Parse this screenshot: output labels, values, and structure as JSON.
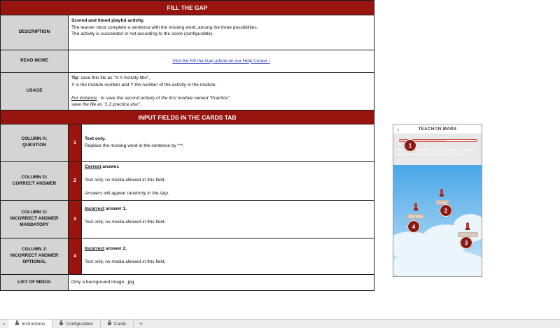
{
  "header": {
    "title": "FILL THE GAP"
  },
  "description": {
    "label": "DESCRIPTION",
    "lines": [
      "Scored and timed playful activity.",
      "The learner must complete a sentence with the missing word, among the three possibilities.",
      "The activity is succeeded or not according to the score (configurable)."
    ]
  },
  "read_more": {
    "label": "READ MORE",
    "link": "Visit the Fill the Gap article on our Help Center !"
  },
  "usage": {
    "label": "USAGE",
    "tip_label": "Tip",
    "tip_text": ": save this file as  \"X.Y-Activity title\",",
    "line2": "X is the module number and Y the number of the activity in the module.",
    "example_label": "For instance",
    "example_text": " : to save the second activity of the first module named \"Practice\",",
    "example_line2": "save the file as \"1.2.practice.xlsx\"."
  },
  "input_header": {
    "title": "INPUT FIELDS IN THE CARDS TAB"
  },
  "columns": [
    {
      "label_line1": "COLUMN A:",
      "label_line2": "QUESTION",
      "label_line3": "",
      "number": "1",
      "title_bold": "Text only.",
      "title_rest": "",
      "line2": "Replace the missing word in the sentence by ***.",
      "line3": ""
    },
    {
      "label_line1": "COLUMN D:",
      "label_line2": "CORRECT ANSWER",
      "label_line3": "",
      "number": "2",
      "title_bold": "Correct",
      "title_rest": " answer.",
      "line2": "Text only, no media allowed in this field.",
      "line3": "Answers will appear randomly in the App."
    },
    {
      "label_line1": "COLUMN G:",
      "label_line2": "INCORRECT ANSWER",
      "label_line3": "MANDATORY",
      "number": "3",
      "title_bold": "Incorrect",
      "title_rest": " answer 1.",
      "line2": "Text only, no media allowed in this field.",
      "line3": ""
    },
    {
      "label_line1": "COLUMN J:",
      "label_line2": "INCORRECT ANSWER",
      "label_line3": "OPTIONAL",
      "number": "4",
      "title_bold": "Incorrect",
      "title_rest": " answer 2.",
      "line2": "Text only, no media allowed in this field.",
      "line3": ""
    }
  ],
  "media": {
    "label": "LIST OF MEDIA",
    "text": "Only a background image: .jpg"
  },
  "preview": {
    "brand_left": "TEACH",
    "brand_mark": "O",
    "brand_right": "N MARS",
    "hint": "The ... question offers a choice between two answers and is usually asked near the end of a meeting.",
    "tag_closed": "Closed",
    "tag_alternative": "Alternative",
    "tag_open": "Open-ended",
    "progress": 0.6,
    "badges": [
      "1",
      "2",
      "3",
      "4"
    ]
  },
  "tabs": [
    {
      "label": "Instructions",
      "active": true
    },
    {
      "label": "Configuration",
      "active": false
    },
    {
      "label": "Cards",
      "active": false
    }
  ],
  "icons": {
    "back": "chevron-left-icon",
    "lock": "lock-icon",
    "add": "plus-icon"
  },
  "colors": {
    "accent": "#98150f",
    "label_bg": "#d4d4d4"
  }
}
